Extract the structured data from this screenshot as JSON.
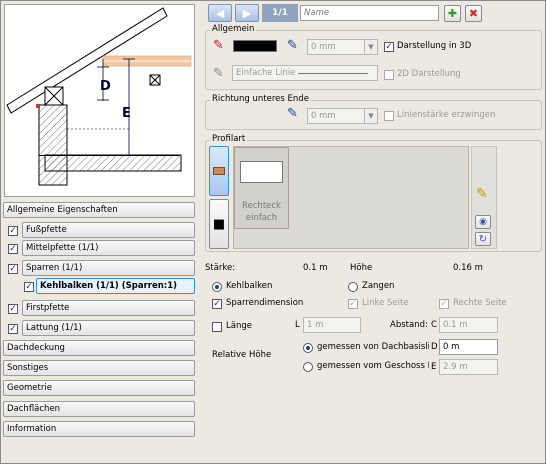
{
  "nav": {
    "page_indicator": "1/1",
    "name_placeholder": "Name"
  },
  "sections": {
    "allgemein": "Allgemein",
    "richtung": "Richtung unteres Ende",
    "profilart": "Profilart"
  },
  "allgemein": {
    "line_width": "0 mm",
    "darstellung_3d": "Darstellung in 3D",
    "line_style": "Einfache Linie",
    "darstellung_2d": "2D Darstellung"
  },
  "richtung": {
    "line_width": "0 mm",
    "force_label": "Linienstärke erzwingen"
  },
  "profil": {
    "tile_label_1": "Rechteck",
    "tile_label_2": "einfach"
  },
  "dimensions": {
    "staerke_label": "Stärke:",
    "staerke_value": "0.1 m",
    "hoehe_label": "Höhe",
    "hoehe_value": "0.16 m"
  },
  "options": {
    "kehlbalken": "Kehlbalken",
    "zangen": "Zangen",
    "sparrendimension": "Sparrendimension",
    "linke_seite": "Linke Seite",
    "rechte_seite": "Rechte Seite",
    "laenge": "Länge",
    "laenge_letter": "L",
    "laenge_value": "1 m",
    "abstand_label": "Abstand:",
    "abstand_letter": "C",
    "abstand_value": "0.1 m",
    "relative_hoehe": "Relative Höhe",
    "gemessen_dachbasis": "gemessen von Dachbasislinie",
    "dach_letter": "D",
    "dach_value": "0 m",
    "gemessen_geschoss": "gemessen vom Geschoss N",
    "geschoss_letter": "E",
    "geschoss_value": "2.9 m"
  },
  "preview": {
    "label_d": "D",
    "label_e": "E"
  },
  "property_list": {
    "header": "Allgemeine Eigenschaften",
    "items": [
      {
        "label": "Fußpfette",
        "checked": true
      },
      {
        "label": "Mittelpfette (1/1)",
        "checked": true
      },
      {
        "label": "Sparren (1/1)",
        "checked": true
      },
      {
        "label": "Kehlbalken (1/1) (Sparren:1)",
        "checked": true
      },
      {
        "label": "Firstpfette",
        "checked": true
      },
      {
        "label": "Lattung (1/1)",
        "checked": true
      }
    ],
    "categories": [
      "Dachdeckung",
      "Sonstiges",
      "Geometrie",
      "Dachflächen",
      "Information"
    ]
  },
  "colors": {
    "accent_blue": "#3a8fd8",
    "add_green": "#2f9a2f",
    "delete_red": "#d22b2b",
    "timber": "#f3c9a1"
  }
}
